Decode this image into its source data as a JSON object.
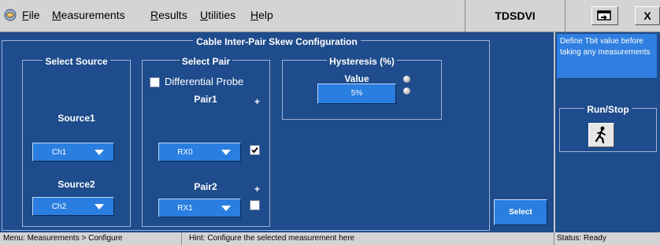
{
  "menu": {
    "items": [
      {
        "label": "File",
        "accel": "F",
        "rest": "ile"
      },
      {
        "label": "Measurements",
        "accel": "M",
        "rest": "easurements"
      },
      {
        "label": "Results",
        "accel": "R",
        "rest": "esults"
      },
      {
        "label": "Utilities",
        "accel": "U",
        "rest": "tilities"
      },
      {
        "label": "Help",
        "accel": "H",
        "rest": "elp"
      }
    ],
    "app_title": "TDSDVI",
    "close_label": "X"
  },
  "config": {
    "title": "Cable Inter-Pair Skew Configuration",
    "source_group": {
      "label": "Select Source",
      "source1_label": "Source1",
      "source1_value": "Ch1",
      "source2_label": "Source2",
      "source2_value": "Ch2"
    },
    "pair_group": {
      "label": "Select Pair",
      "differential_probe_label": "Differential Probe",
      "differential_probe_checked": false,
      "pair1_label": "Pair1",
      "pair1_value": "RX0",
      "pair1_plus": "+",
      "pair1_checked": true,
      "pair2_label": "Pair2",
      "pair2_value": "RX1",
      "pair2_plus": "+",
      "pair2_checked": false
    },
    "hysteresis_group": {
      "label": "Hysteresis (%)",
      "value_label": "Value",
      "value": "5%"
    },
    "select_button": "Select"
  },
  "side_panel": {
    "info_text": "Define Tbit value before taking any measurements",
    "runstop_label": "Run/Stop"
  },
  "status_bar": {
    "menu_path": "Menu: Measurements > Configure",
    "hint": "Hint: Configure the selected measurement here",
    "status": "Status: Ready"
  },
  "colors": {
    "panel_bg": "#1e4c8c",
    "control_blue": "#2a7ee0",
    "chrome_gray": "#d4d4d4"
  }
}
